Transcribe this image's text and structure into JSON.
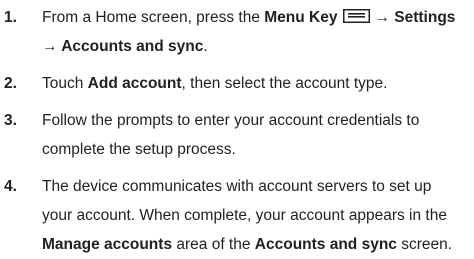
{
  "steps": [
    {
      "number": "1.",
      "line1_a": "From a Home screen, press the ",
      "line1_b": "Menu Key",
      "line1_c": "→ Settings",
      "line2": "→ Accounts and sync",
      "line2_end": "."
    },
    {
      "number": "2.",
      "a": "Touch ",
      "b": "Add account",
      "c": ", then select the account type."
    },
    {
      "number": "3.",
      "line1": "Follow the prompts to enter your account credentials to",
      "line2": "complete the setup process."
    },
    {
      "number": "4.",
      "line1": "The device communicates with account servers to set up",
      "line2": "your account. When complete, your account appears in the",
      "line3_a": "Manage accounts",
      "line3_b": " area of the ",
      "line3_c": "Accounts and sync",
      "line3_d": " screen."
    }
  ],
  "icons": {
    "menu_key": "menu-key-icon"
  }
}
